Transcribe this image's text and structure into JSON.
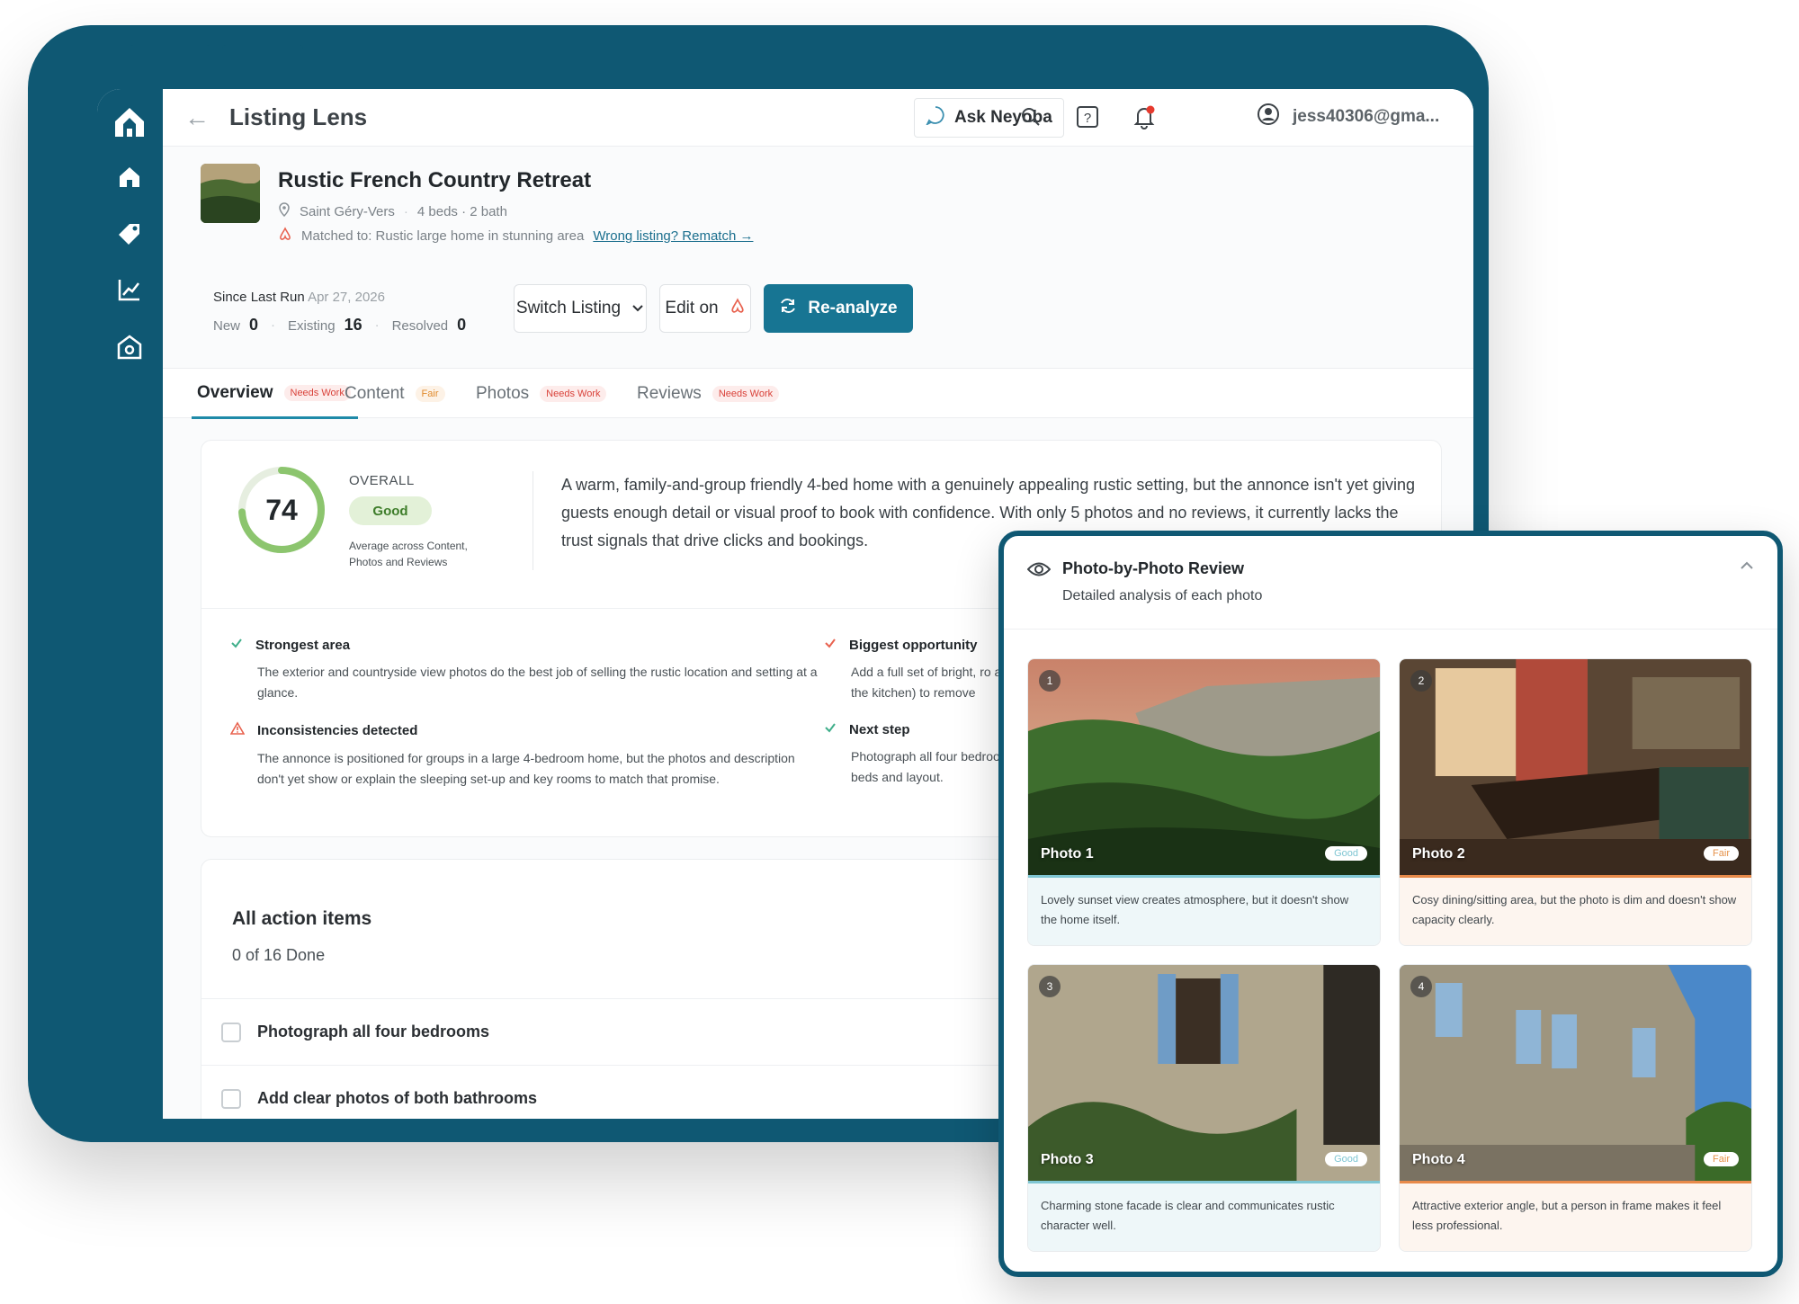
{
  "app": {
    "title": "Listing Lens",
    "back_icon": "arrow-left-icon"
  },
  "topbar": {
    "ask_label": "Ask Neyoba",
    "user_email": "jess40306@gma..."
  },
  "listing": {
    "title": "Rustic French Country Retreat",
    "location": "Saint Géry-Vers",
    "specs": "4 beds · 2 bath",
    "matched_text": "Matched to: Rustic large home in stunning area",
    "rematch_link": "Wrong listing? Rematch →"
  },
  "since_run": {
    "label": "Since Last Run",
    "date": "Apr 27, 2026",
    "new_label": "New",
    "new_value": "0",
    "existing_label": "Existing",
    "existing_value": "16",
    "resolved_label": "Resolved",
    "resolved_value": "0"
  },
  "actions": {
    "switch_listing": "Switch Listing",
    "edit_on": "Edit on",
    "reanalyze": "Re-analyze"
  },
  "tabs": [
    {
      "label": "Overview",
      "badge": "Needs Work"
    },
    {
      "label": "Content",
      "badge": "Fair"
    },
    {
      "label": "Photos",
      "badge": "Needs Work"
    },
    {
      "label": "Reviews",
      "badge": "Needs Work"
    }
  ],
  "overview": {
    "score": "74",
    "score_fraction": 0.74,
    "overall_label": "OVERALL",
    "rating": "Good",
    "rating_sub": "Average across Content, Photos and Reviews",
    "summary": "A warm, family-and-group friendly 4-bed home with a genuinely appealing rustic setting, but the annonce isn't yet giving guests enough detail or visual proof to book with confidence. With only 5 photos and no reviews, it currently lacks the trust signals that drive clicks and bookings.",
    "insights": [
      {
        "title": "Strongest area",
        "body": "The exterior and countryside view photos do the best job of selling the rustic location and setting at a glance."
      },
      {
        "title": "Biggest opportunity",
        "body": "Add a full set of bright, ro and the kitchen) to remove"
      },
      {
        "title": "Inconsistencies detected",
        "body": "The annonce is positioned for groups in a large 4-bedroom home, but the photos and description don't yet show or explain the sleeping set-up and key rooms to match that promise."
      },
      {
        "title": "Next step",
        "body": "Photograph all four bedroo beds and layout."
      }
    ]
  },
  "action_items": {
    "title": "All action items",
    "count": "0 of 16 Done",
    "items": [
      "Photograph all four bedrooms",
      "Add clear photos of both bathrooms"
    ]
  },
  "photo_review": {
    "title": "Photo-by-Photo Review",
    "subtitle": "Detailed analysis of each photo",
    "photos": [
      {
        "num": "1",
        "label": "Photo 1",
        "badge": "Good",
        "caption": "Lovely sunset view creates atmosphere, but it doesn't show the home itself."
      },
      {
        "num": "2",
        "label": "Photo 2",
        "badge": "Fair",
        "caption": "Cosy dining/sitting area, but the photo is dim and doesn't show capacity clearly."
      },
      {
        "num": "3",
        "label": "Photo 3",
        "badge": "Good",
        "caption": "Charming stone facade is clear and communicates rustic character well."
      },
      {
        "num": "4",
        "label": "Photo 4",
        "badge": "Fair",
        "caption": "Attractive exterior angle, but a person in frame makes it feel less professional."
      }
    ]
  },
  "colors": {
    "brand": "#0f5873",
    "primary_button": "#177593",
    "good": "#7fc6d3",
    "fair": "#e88a4a",
    "needs_work": "#d9423a",
    "score_ring": "#8cc56e"
  }
}
